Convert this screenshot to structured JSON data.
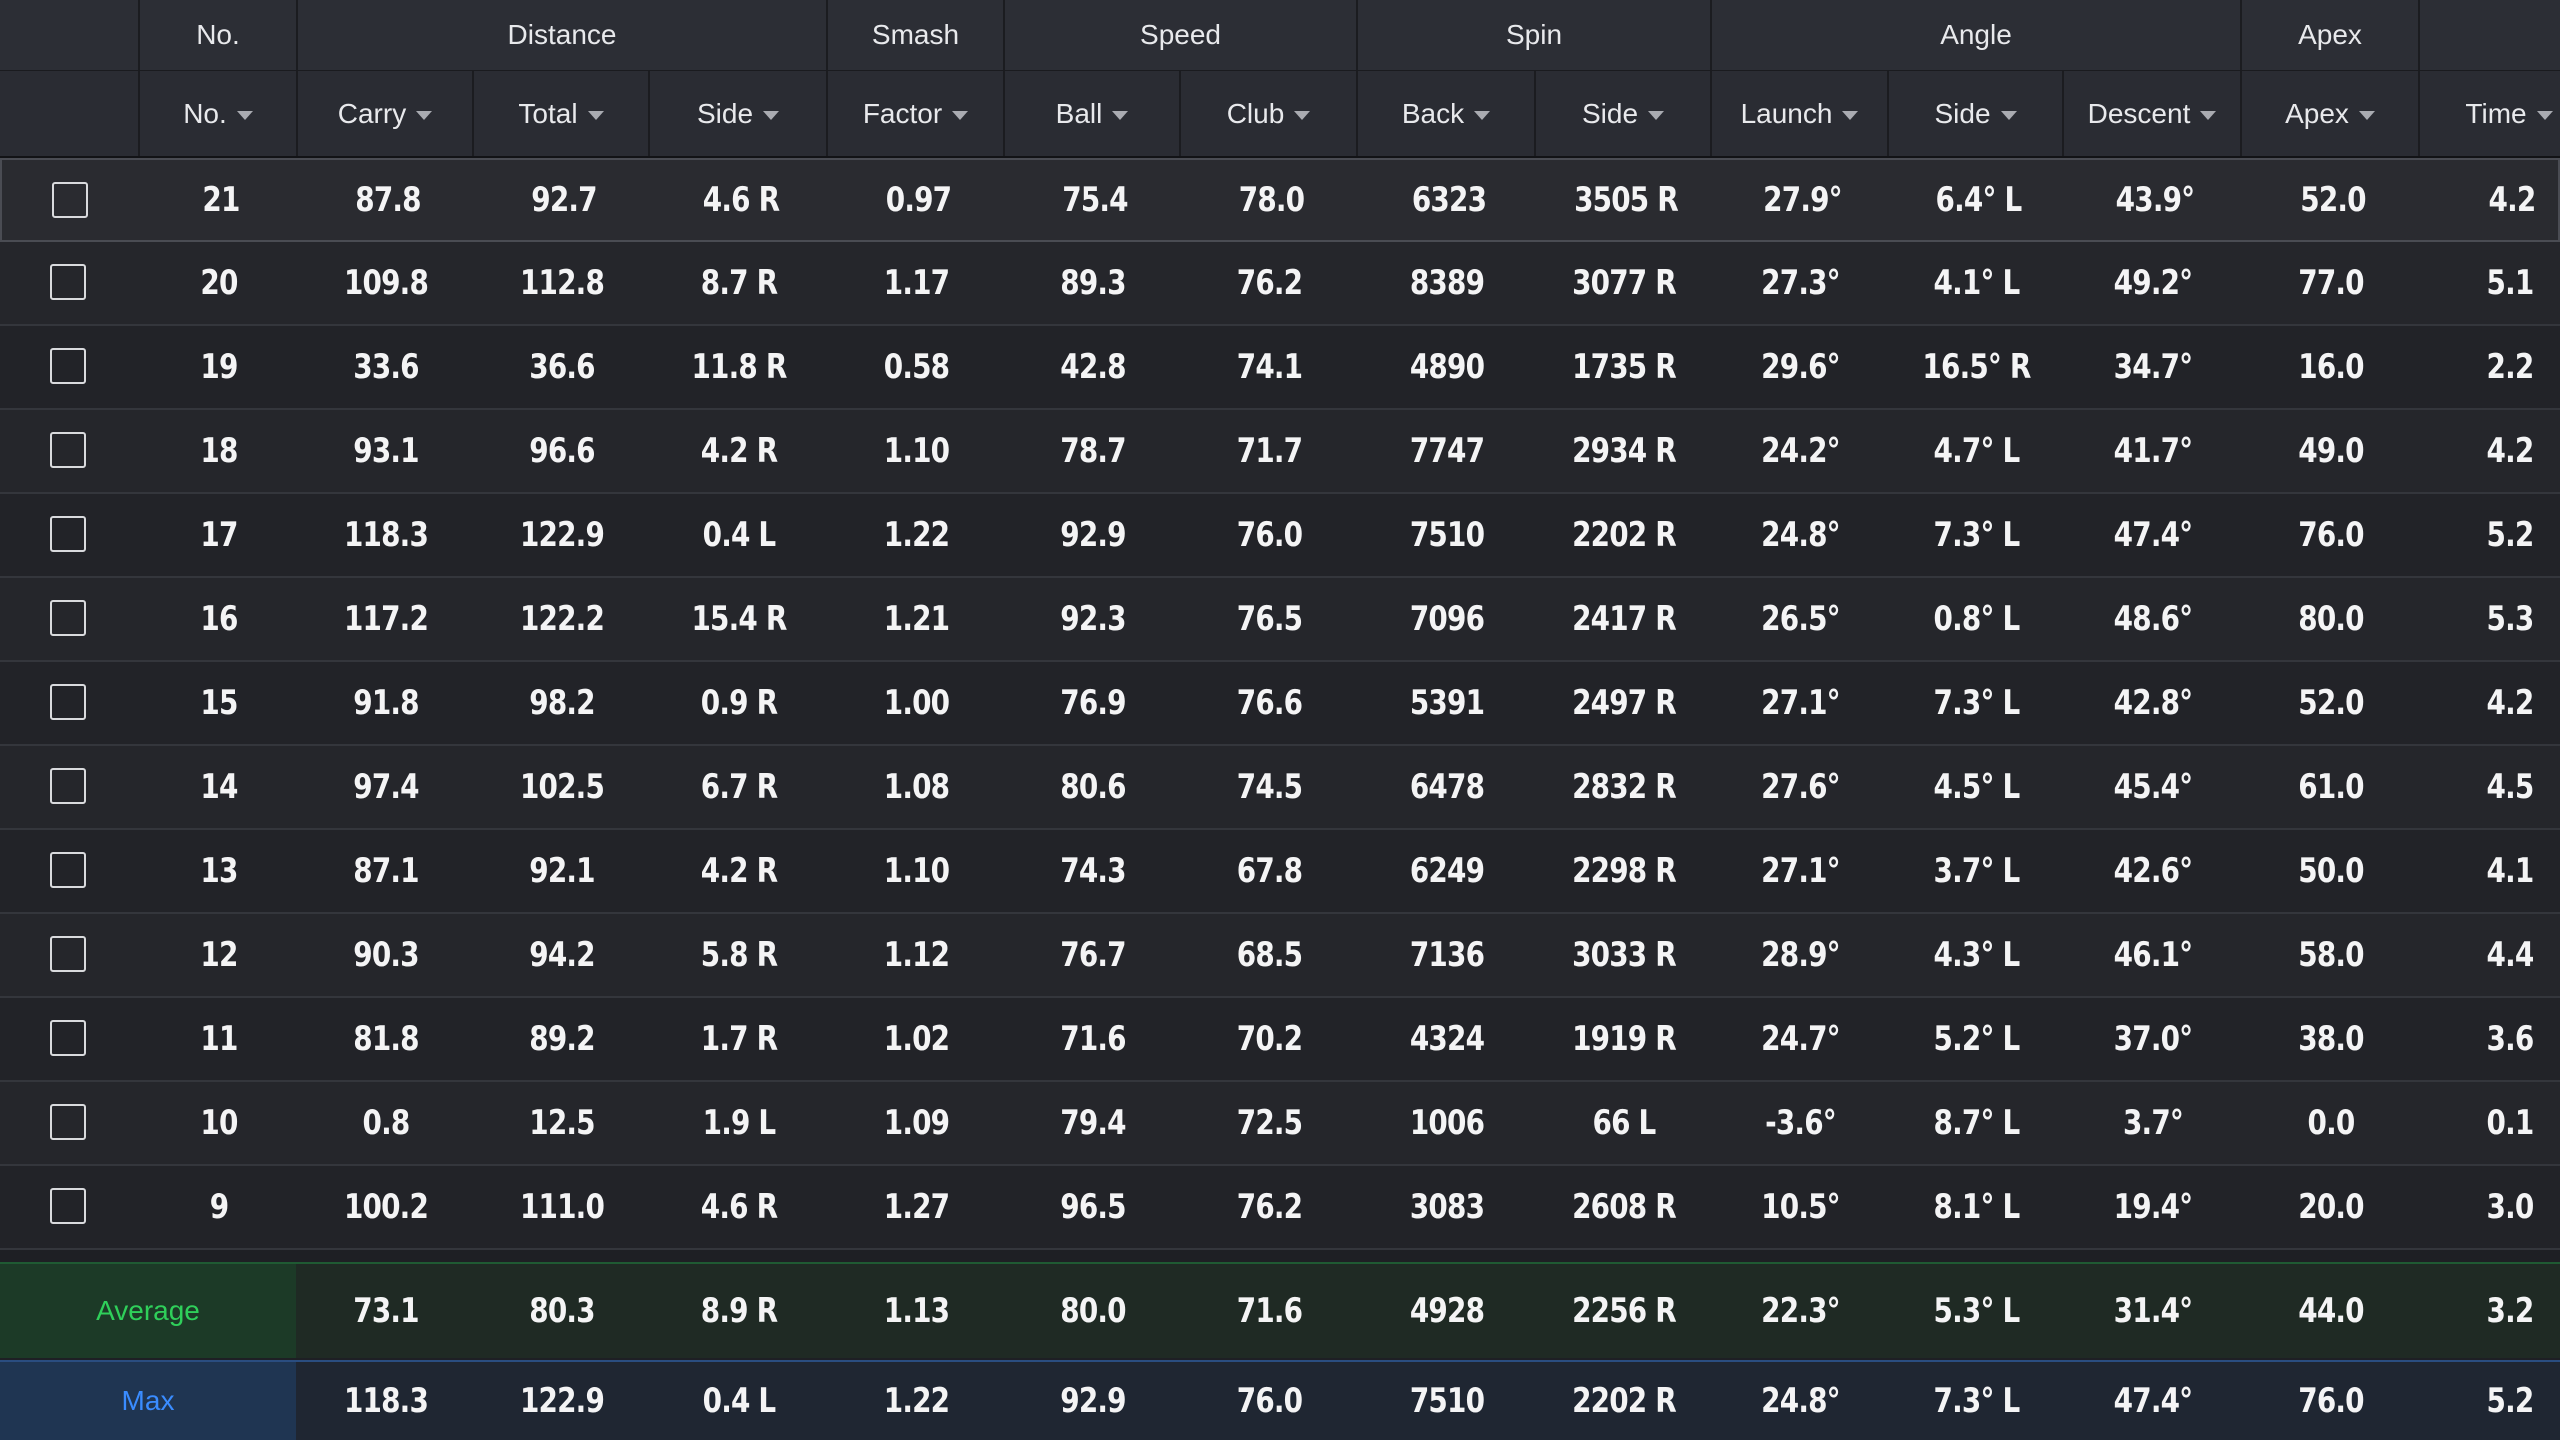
{
  "header_groups": [
    "",
    "No.",
    "Distance",
    "Smash",
    "Speed",
    "Spin",
    "Angle",
    "Apex",
    ""
  ],
  "columns": [
    "",
    "No.",
    "Carry",
    "Total",
    "Side",
    "Factor",
    "Ball",
    "Club",
    "Back",
    "Side",
    "Launch",
    "Side",
    "Descent",
    "Apex",
    "Time"
  ],
  "rows": [
    [
      "21",
      "87.8",
      "92.7",
      "4.6 R",
      "0.97",
      "75.4",
      "78.0",
      "6323",
      "3505 R",
      "27.9°",
      "6.4° L",
      "43.9°",
      "52.0",
      "4.2"
    ],
    [
      "20",
      "109.8",
      "112.8",
      "8.7 R",
      "1.17",
      "89.3",
      "76.2",
      "8389",
      "3077 R",
      "27.3°",
      "4.1° L",
      "49.2°",
      "77.0",
      "5.1"
    ],
    [
      "19",
      "33.6",
      "36.6",
      "11.8 R",
      "0.58",
      "42.8",
      "74.1",
      "4890",
      "1735 R",
      "29.6°",
      "16.5° R",
      "34.7°",
      "16.0",
      "2.2"
    ],
    [
      "18",
      "93.1",
      "96.6",
      "4.2 R",
      "1.10",
      "78.7",
      "71.7",
      "7747",
      "2934 R",
      "24.2°",
      "4.7° L",
      "41.7°",
      "49.0",
      "4.2"
    ],
    [
      "17",
      "118.3",
      "122.9",
      "0.4 L",
      "1.22",
      "92.9",
      "76.0",
      "7510",
      "2202 R",
      "24.8°",
      "7.3° L",
      "47.4°",
      "76.0",
      "5.2"
    ],
    [
      "16",
      "117.2",
      "122.2",
      "15.4 R",
      "1.21",
      "92.3",
      "76.5",
      "7096",
      "2417 R",
      "26.5°",
      "0.8° L",
      "48.6°",
      "80.0",
      "5.3"
    ],
    [
      "15",
      "91.8",
      "98.2",
      "0.9 R",
      "1.00",
      "76.9",
      "76.6",
      "5391",
      "2497 R",
      "27.1°",
      "7.3° L",
      "42.8°",
      "52.0",
      "4.2"
    ],
    [
      "14",
      "97.4",
      "102.5",
      "6.7 R",
      "1.08",
      "80.6",
      "74.5",
      "6478",
      "2832 R",
      "27.6°",
      "4.5° L",
      "45.4°",
      "61.0",
      "4.5"
    ],
    [
      "13",
      "87.1",
      "92.1",
      "4.2 R",
      "1.10",
      "74.3",
      "67.8",
      "6249",
      "2298 R",
      "27.1°",
      "3.7° L",
      "42.6°",
      "50.0",
      "4.1"
    ],
    [
      "12",
      "90.3",
      "94.2",
      "5.8 R",
      "1.12",
      "76.7",
      "68.5",
      "7136",
      "3033 R",
      "28.9°",
      "4.3° L",
      "46.1°",
      "58.0",
      "4.4"
    ],
    [
      "11",
      "81.8",
      "89.2",
      "1.7 R",
      "1.02",
      "71.6",
      "70.2",
      "4324",
      "1919 R",
      "24.7°",
      "5.2° L",
      "37.0°",
      "38.0",
      "3.6"
    ],
    [
      "10",
      "0.8",
      "12.5",
      "1.9 L",
      "1.09",
      "79.4",
      "72.5",
      "1006",
      "66 L",
      "-3.6°",
      "8.7° L",
      "3.7°",
      "0.0",
      "0.1"
    ],
    [
      "9",
      "100.2",
      "111.0",
      "4.6 R",
      "1.27",
      "96.5",
      "76.2",
      "3083",
      "2608 R",
      "10.5°",
      "8.1° L",
      "19.4°",
      "20.0",
      "3.0"
    ]
  ],
  "summary": {
    "average": {
      "label": "Average",
      "values": [
        "73.1",
        "80.3",
        "8.9 R",
        "1.13",
        "80.0",
        "71.6",
        "4928",
        "2256 R",
        "22.3°",
        "5.3° L",
        "31.4°",
        "44.0",
        "3.2"
      ]
    },
    "max": {
      "label": "Max",
      "values": [
        "118.3",
        "122.9",
        "0.4 L",
        "1.22",
        "92.9",
        "76.0",
        "7510",
        "2202 R",
        "24.8°",
        "7.3° L",
        "47.4°",
        "76.0",
        "5.2"
      ]
    }
  }
}
